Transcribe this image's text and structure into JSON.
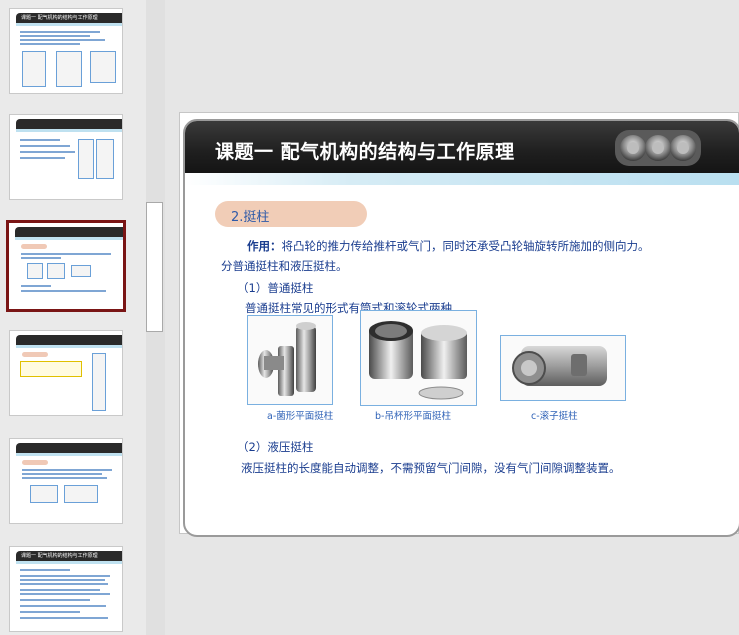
{
  "thumbnails": [
    {
      "title": "课题一  配气机构的结构与工作原理",
      "selected": false
    },
    {
      "title": "",
      "selected": false
    },
    {
      "title": "",
      "selected": true
    },
    {
      "title": "",
      "selected": false
    },
    {
      "title": "",
      "selected": false
    },
    {
      "title": "课题一  配气机构的结构与工作原理",
      "selected": false
    }
  ],
  "slide": {
    "title": "课题一  配气机构的结构与工作原理",
    "section": "2.挺柱",
    "line1_lead": "作用：",
    "line1_rest": "将凸轮的推力传给推杆或气门，同时还承受凸轮轴旋转所施加的侧向力。",
    "line2": "分普通挺柱和液压挺柱。",
    "sub1_heading": "（1）普通挺柱",
    "sub1_text": "普通挺柱常见的形式有筒式和滚轮式两种",
    "captions": [
      "a-菌形平面挺柱",
      "b-吊杯形平面挺柱",
      "c-滚子挺柱"
    ],
    "sub2_heading": "（2）液压挺柱",
    "sub2_text": "液压挺柱的长度能自动调整，不需预留气门间隙，没有气门间隙调整装置。"
  },
  "colors": {
    "text_blue": "#1a3d8f",
    "caption_blue": "#2f62b7",
    "pill": "#f1cdb7",
    "selected_border": "#7a1515"
  }
}
